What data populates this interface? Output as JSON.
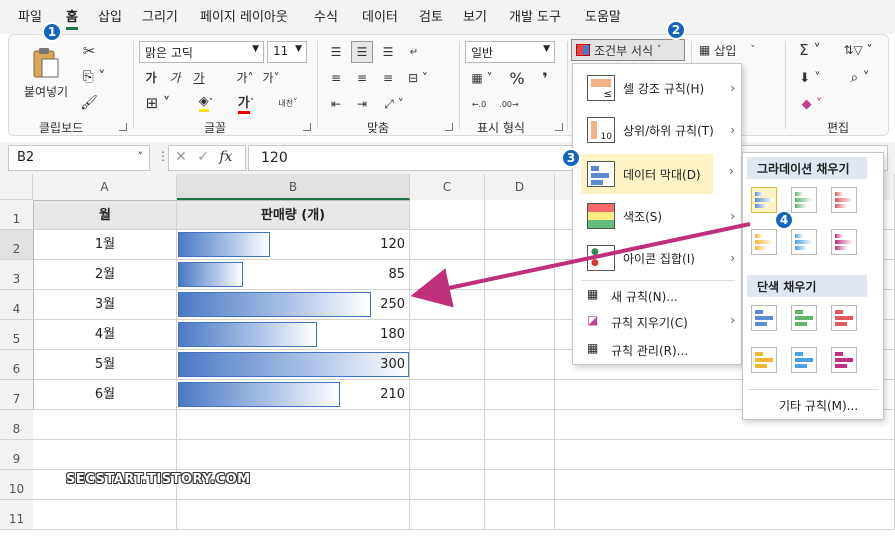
{
  "menubar": {
    "tabs": [
      "파일",
      "홈",
      "삽입",
      "그리기",
      "페이지 레이아웃",
      "수식",
      "데이터",
      "검토",
      "보기",
      "개발 도구",
      "도움말"
    ]
  },
  "ribbon": {
    "paste_label": "붙여넣기",
    "groups": {
      "clipboard": "클립보드",
      "font": "글꼴",
      "alignment": "맞춤",
      "number": "표시 형식",
      "editing": "편집"
    },
    "font_name": "맑은 고딕",
    "font_size": "11",
    "number_format": "일반",
    "conditional_format": "조건부 서식",
    "insert": "삽입",
    "font_buttons": [
      "가",
      "가",
      "가",
      "가˄",
      "가˅"
    ],
    "wrap_label": "내천"
  },
  "formula": {
    "name_box": "B2",
    "fx": "fx",
    "value": "120"
  },
  "sheet": {
    "columns": [
      "A",
      "B",
      "C",
      "D"
    ],
    "rows": [
      "1",
      "2",
      "3",
      "4",
      "5",
      "6",
      "7",
      "8",
      "9",
      "10",
      "11"
    ],
    "header": [
      "월",
      "판매량 (개)"
    ],
    "data": [
      {
        "month": "1월",
        "value": 120
      },
      {
        "month": "2월",
        "value": 85
      },
      {
        "month": "3월",
        "value": 250
      },
      {
        "month": "4월",
        "value": 180
      },
      {
        "month": "5월",
        "value": 300
      },
      {
        "month": "6월",
        "value": 210
      }
    ],
    "max": 300
  },
  "cf_menu": {
    "items": [
      {
        "label": "셀 강조 규칙(H)"
      },
      {
        "label": "상위/하위 규칙(T)"
      },
      {
        "label": "데이터 막대(D)"
      },
      {
        "label": "색조(S)"
      },
      {
        "label": "아이콘 집합(I)"
      }
    ],
    "small_items": [
      "새 규칙(N)...",
      "규칙 지우기(C)",
      "규칙 관리(R)..."
    ]
  },
  "submenu": {
    "gradient_title": "그라데이션 채우기",
    "solid_title": "단색 채우기",
    "more": "기타 규칙(M)...",
    "colors": [
      "#5b8bd0",
      "#63b36b",
      "#e0595d",
      "#f2b431",
      "#4aa3e8",
      "#c4307f"
    ]
  },
  "badges": [
    "1",
    "2",
    "3",
    "4"
  ],
  "watermark": "SECSTART.TISTORY.COM",
  "colors": {
    "accent": "#217346",
    "badge": "#1565c0",
    "arrow": "#c0307a",
    "bar": "#4472c4"
  }
}
